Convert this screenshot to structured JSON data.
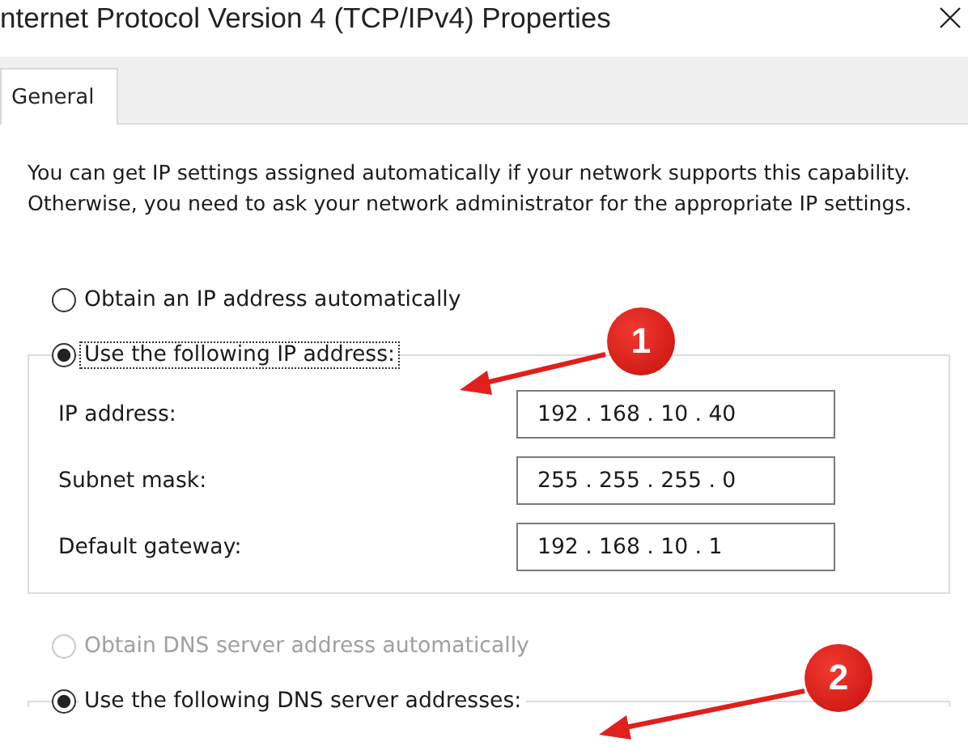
{
  "window": {
    "title": "nternet Protocol Version 4 (TCP/IPv4) Properties"
  },
  "tabs": [
    {
      "label": "General",
      "selected": true
    }
  ],
  "description": "You can get IP settings assigned automatically if your network supports this capability. Otherwise, you need to ask your network administrator for the appropriate IP settings.",
  "ip_mode": [
    {
      "label": "Obtain an IP address automatically",
      "selected": false,
      "disabled": false,
      "focused": false
    },
    {
      "label": "Use the following IP address:",
      "selected": true,
      "disabled": false,
      "focused": true
    }
  ],
  "ip_fields": [
    {
      "label": "IP address:",
      "value": "192 . 168 . 10 . 40"
    },
    {
      "label": "Subnet mask:",
      "value": "255 . 255 . 255 . 0"
    },
    {
      "label": "Default gateway:",
      "value": "192 . 168 . 10 . 1"
    }
  ],
  "dns_mode": [
    {
      "label": "Obtain DNS server address automatically",
      "selected": false,
      "disabled": true,
      "focused": false
    },
    {
      "label": "Use the following DNS server addresses:",
      "selected": true,
      "disabled": false,
      "focused": false
    }
  ],
  "annotations": [
    {
      "text": "1"
    },
    {
      "text": "2"
    }
  ]
}
